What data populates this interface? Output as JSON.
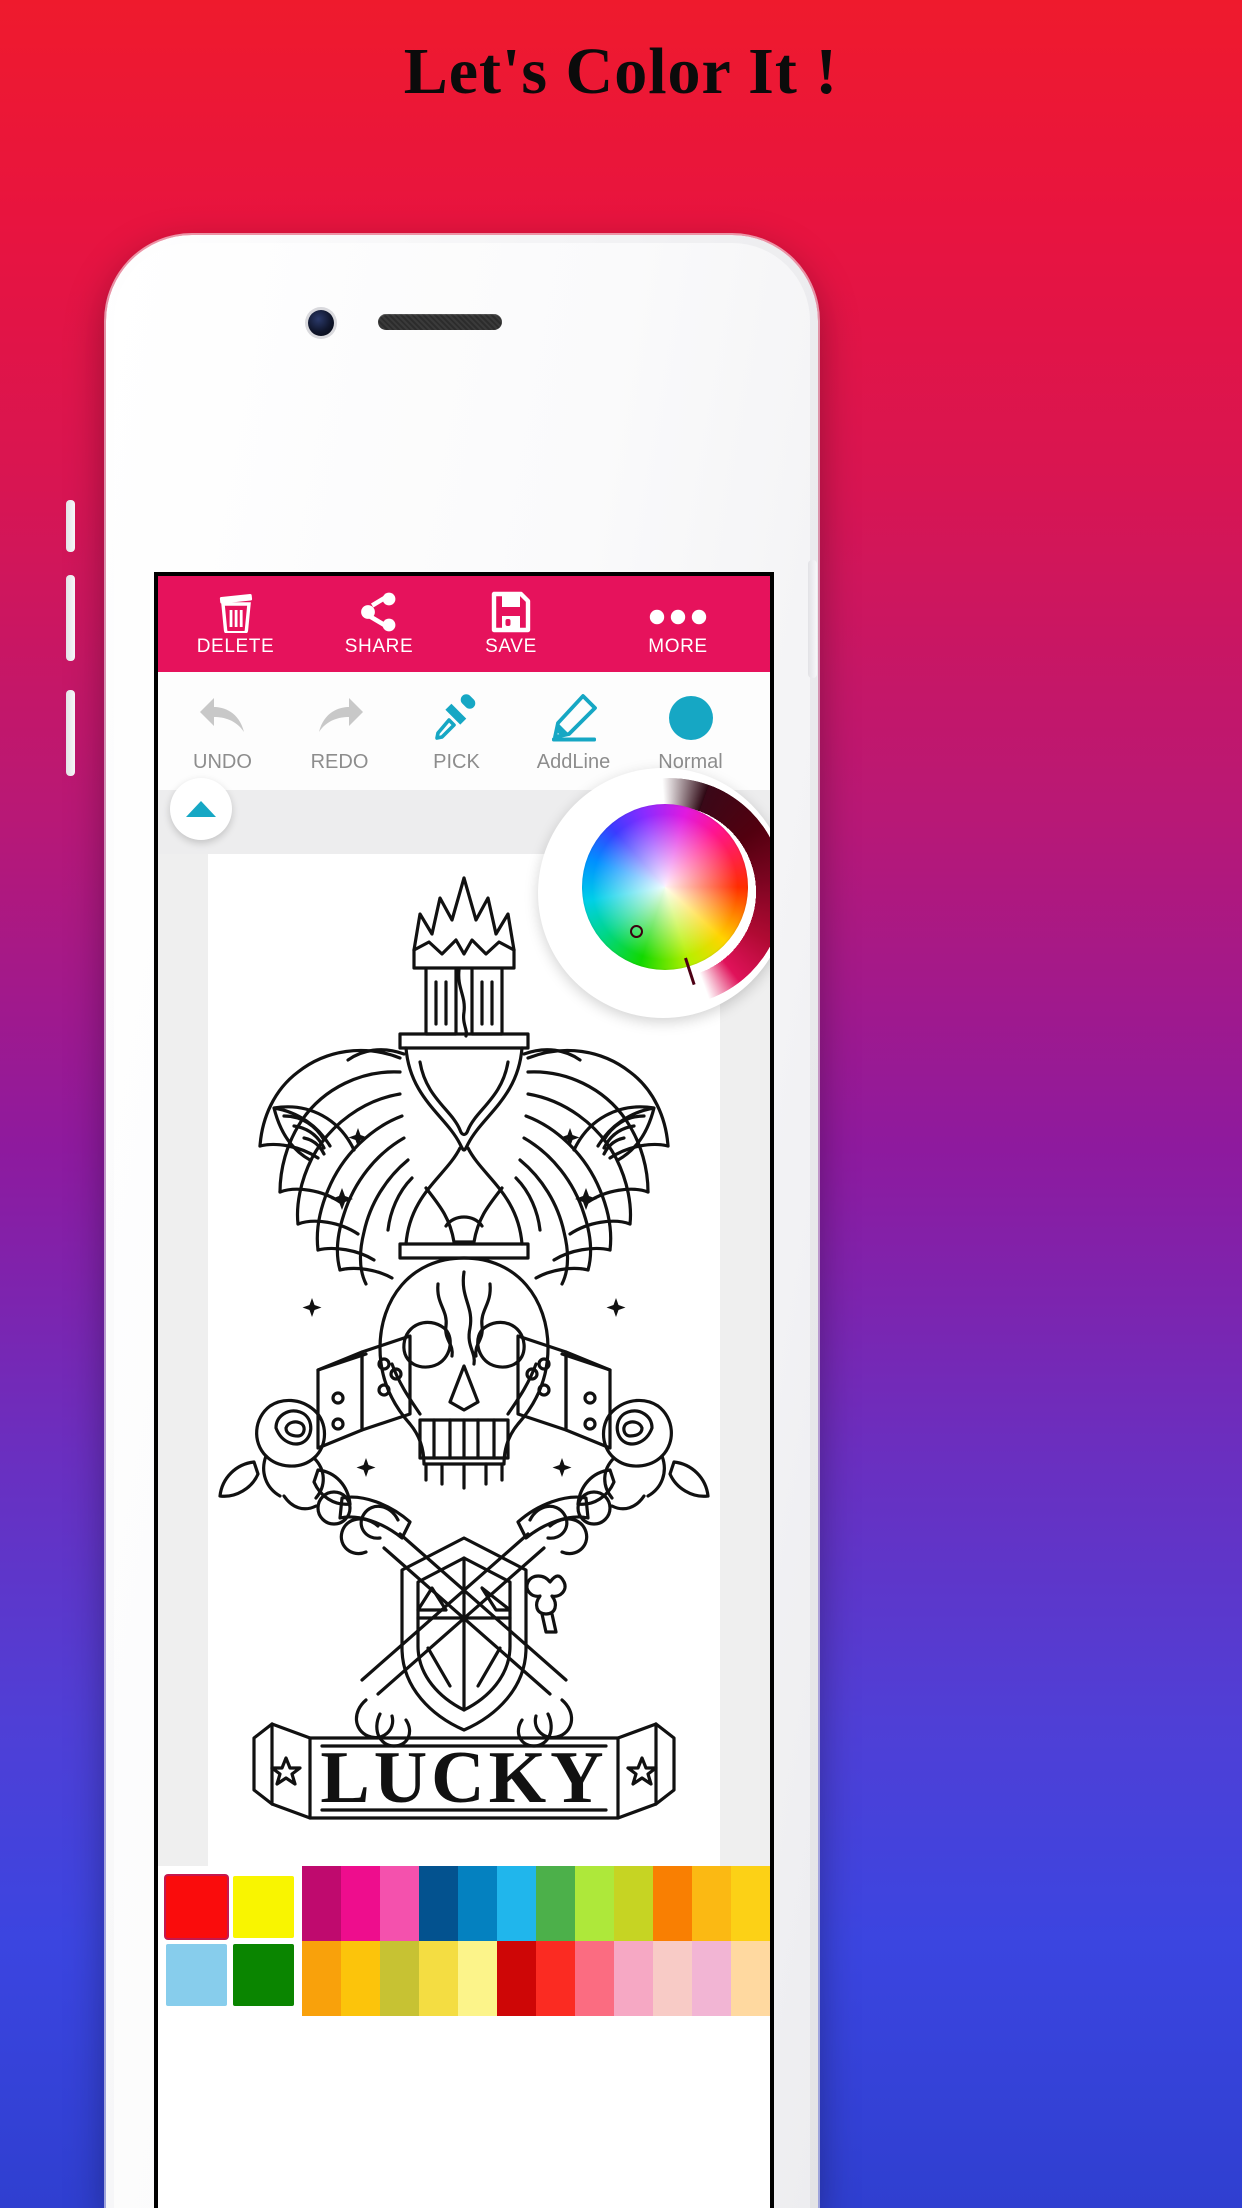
{
  "promo": {
    "title": "Let's Color It !"
  },
  "device": {
    "camera_icon": "front-camera",
    "speaker_icon": "earpiece-speaker"
  },
  "app": {
    "topbar": {
      "background": "#e6125c",
      "items": [
        {
          "label": "DELETE",
          "icon": "trash-icon"
        },
        {
          "label": "SHARE",
          "icon": "share-icon"
        },
        {
          "label": "SAVE",
          "icon": "floppy-disk-icon"
        },
        {
          "label": "MORE",
          "icon": "overflow-dots-icon"
        }
      ]
    },
    "toolrow": {
      "accent": "#16a7c4",
      "disabled": "#c8c8c8",
      "items": [
        {
          "label": "UNDO",
          "icon": "undo-arrow-icon",
          "state": "disabled"
        },
        {
          "label": "REDO",
          "icon": "redo-arrow-icon",
          "state": "disabled"
        },
        {
          "label": "PICK",
          "icon": "eyedropper-icon",
          "state": "enabled"
        },
        {
          "label": "AddLine",
          "icon": "pencil-icon",
          "state": "enabled"
        },
        {
          "label": "Normal",
          "icon": "filled-circle-icon",
          "state": "enabled"
        }
      ]
    },
    "color_wheel": {
      "icon": "hsv-color-wheel",
      "selected_color": "#ff0f86",
      "arc_color": "#5a0a22"
    },
    "collapse_button": {
      "icon": "triangle-up-icon",
      "color": "#16a7c4"
    },
    "canvas": {
      "artwork_title": "LUCKY",
      "description": "Tattoo-style line art: winged hourglass, flaming skull, dice, roses, crossbones and LUCKY banner"
    },
    "palette": {
      "recent_colors": [
        "#fa0c0c",
        "#f9f500",
        "#87cdec",
        "#0a8500"
      ],
      "recent_selected_index": 0,
      "swatch_rows": [
        [
          "#bf0a6e",
          "#ee0d8d",
          "#f451ad",
          "#03528f",
          "#0481c0",
          "#20b6ec",
          "#4cb04a",
          "#aee83a",
          "#c6d423",
          "#f97f02",
          "#fbb913",
          "#fcd116"
        ],
        [
          "#f9a10b",
          "#fcc40b",
          "#c7c233",
          "#f4dd42",
          "#fcf48a",
          "#ce0606",
          "#fb2b22",
          "#fb6c81",
          "#f6a8c4",
          "#f8cbc6",
          "#f2b5d4",
          "#ffd9a0"
        ]
      ]
    }
  }
}
